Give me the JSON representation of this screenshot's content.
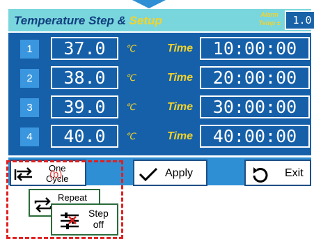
{
  "header": {
    "title_main": "Temperature Step & ",
    "title_accent": "Setup",
    "alarm_label_line1": "Alarm",
    "alarm_label_line2": "Temp ±",
    "alarm_value": "1.0"
  },
  "steps": [
    {
      "number": "1",
      "temperature": "37.0",
      "unit": "℃",
      "time_label": "Time",
      "time": "10:00:00"
    },
    {
      "number": "2",
      "temperature": "38.0",
      "unit": "℃",
      "time_label": "Time",
      "time": "20:00:00"
    },
    {
      "number": "3",
      "temperature": "39.0",
      "unit": "℃",
      "time_label": "Time",
      "time": "30:00:00"
    },
    {
      "number": "4",
      "temperature": "40.0",
      "unit": "℃",
      "time_label": "Time",
      "time": "40:00:00"
    }
  ],
  "buttons": {
    "one_cycle_line1": "One",
    "one_cycle_line2": "Cycle",
    "apply": "Apply",
    "exit": "Exit",
    "repeat": "Repeat",
    "step_off_line1": "Step",
    "step_off_line2": "off"
  },
  "annotation": {
    "marker": "(b)",
    "marker_color": "#e02020"
  },
  "colors": {
    "panel": "#1660a9",
    "header": "#79d6dd",
    "accent_yellow": "#f3d32a",
    "bottom_bar": "#2e8fd4",
    "highlight_dash": "#e02020"
  },
  "icons": {
    "one_cycle": "one-cycle-icon",
    "apply": "checkmark-icon",
    "exit": "undo-arrow-icon",
    "repeat": "repeat-icon",
    "step_off": "sliders-off-icon"
  }
}
